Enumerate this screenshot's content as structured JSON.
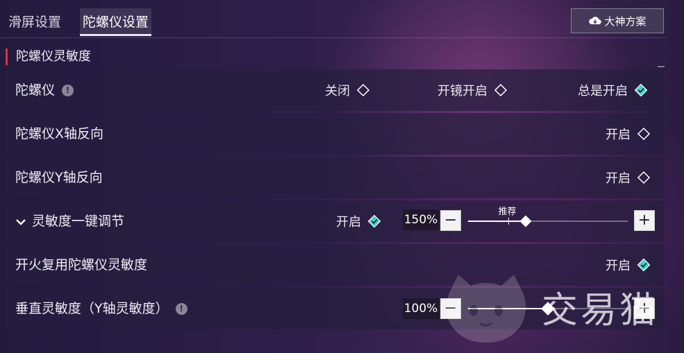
{
  "tabs": [
    {
      "label": "滑屏设置",
      "active": false
    },
    {
      "label": "陀螺仪设置",
      "active": true
    }
  ],
  "god_button": {
    "label": "大神方案",
    "icon": "cloud-download-icon"
  },
  "section": {
    "title": "陀螺仪灵敏度"
  },
  "rows": {
    "gyro": {
      "label": "陀螺仪",
      "info": "!",
      "options": [
        {
          "label": "关闭",
          "selected": false
        },
        {
          "label": "开镜开启",
          "selected": false
        },
        {
          "label": "总是开启",
          "selected": true
        }
      ]
    },
    "x_invert": {
      "label": "陀螺仪X轴反向",
      "option": {
        "label": "开启",
        "selected": false
      }
    },
    "y_invert": {
      "label": "陀螺仪Y轴反向",
      "option": {
        "label": "开启",
        "selected": false
      }
    },
    "one_key": {
      "label": "灵敏度一键调节",
      "option": {
        "label": "开启",
        "selected": true
      },
      "value_text": "150%",
      "value_fraction": 0.36,
      "recommended_label": "推荐",
      "recommended_fraction": 0.25,
      "minus": "−",
      "plus": "+"
    },
    "fire_reuse": {
      "label": "开火复用陀螺仪灵敏度",
      "option": {
        "label": "开启",
        "selected": true
      }
    },
    "vertical": {
      "label": "垂直灵敏度（Y轴灵敏度）",
      "info": "!",
      "value_text": "100%",
      "value_fraction": 0.5,
      "minus": "−",
      "plus": "+"
    }
  },
  "watermark": {
    "text": "交易猫"
  },
  "colors": {
    "accent_red": "#e0313f",
    "selected_teal": "#3fd2c7"
  }
}
